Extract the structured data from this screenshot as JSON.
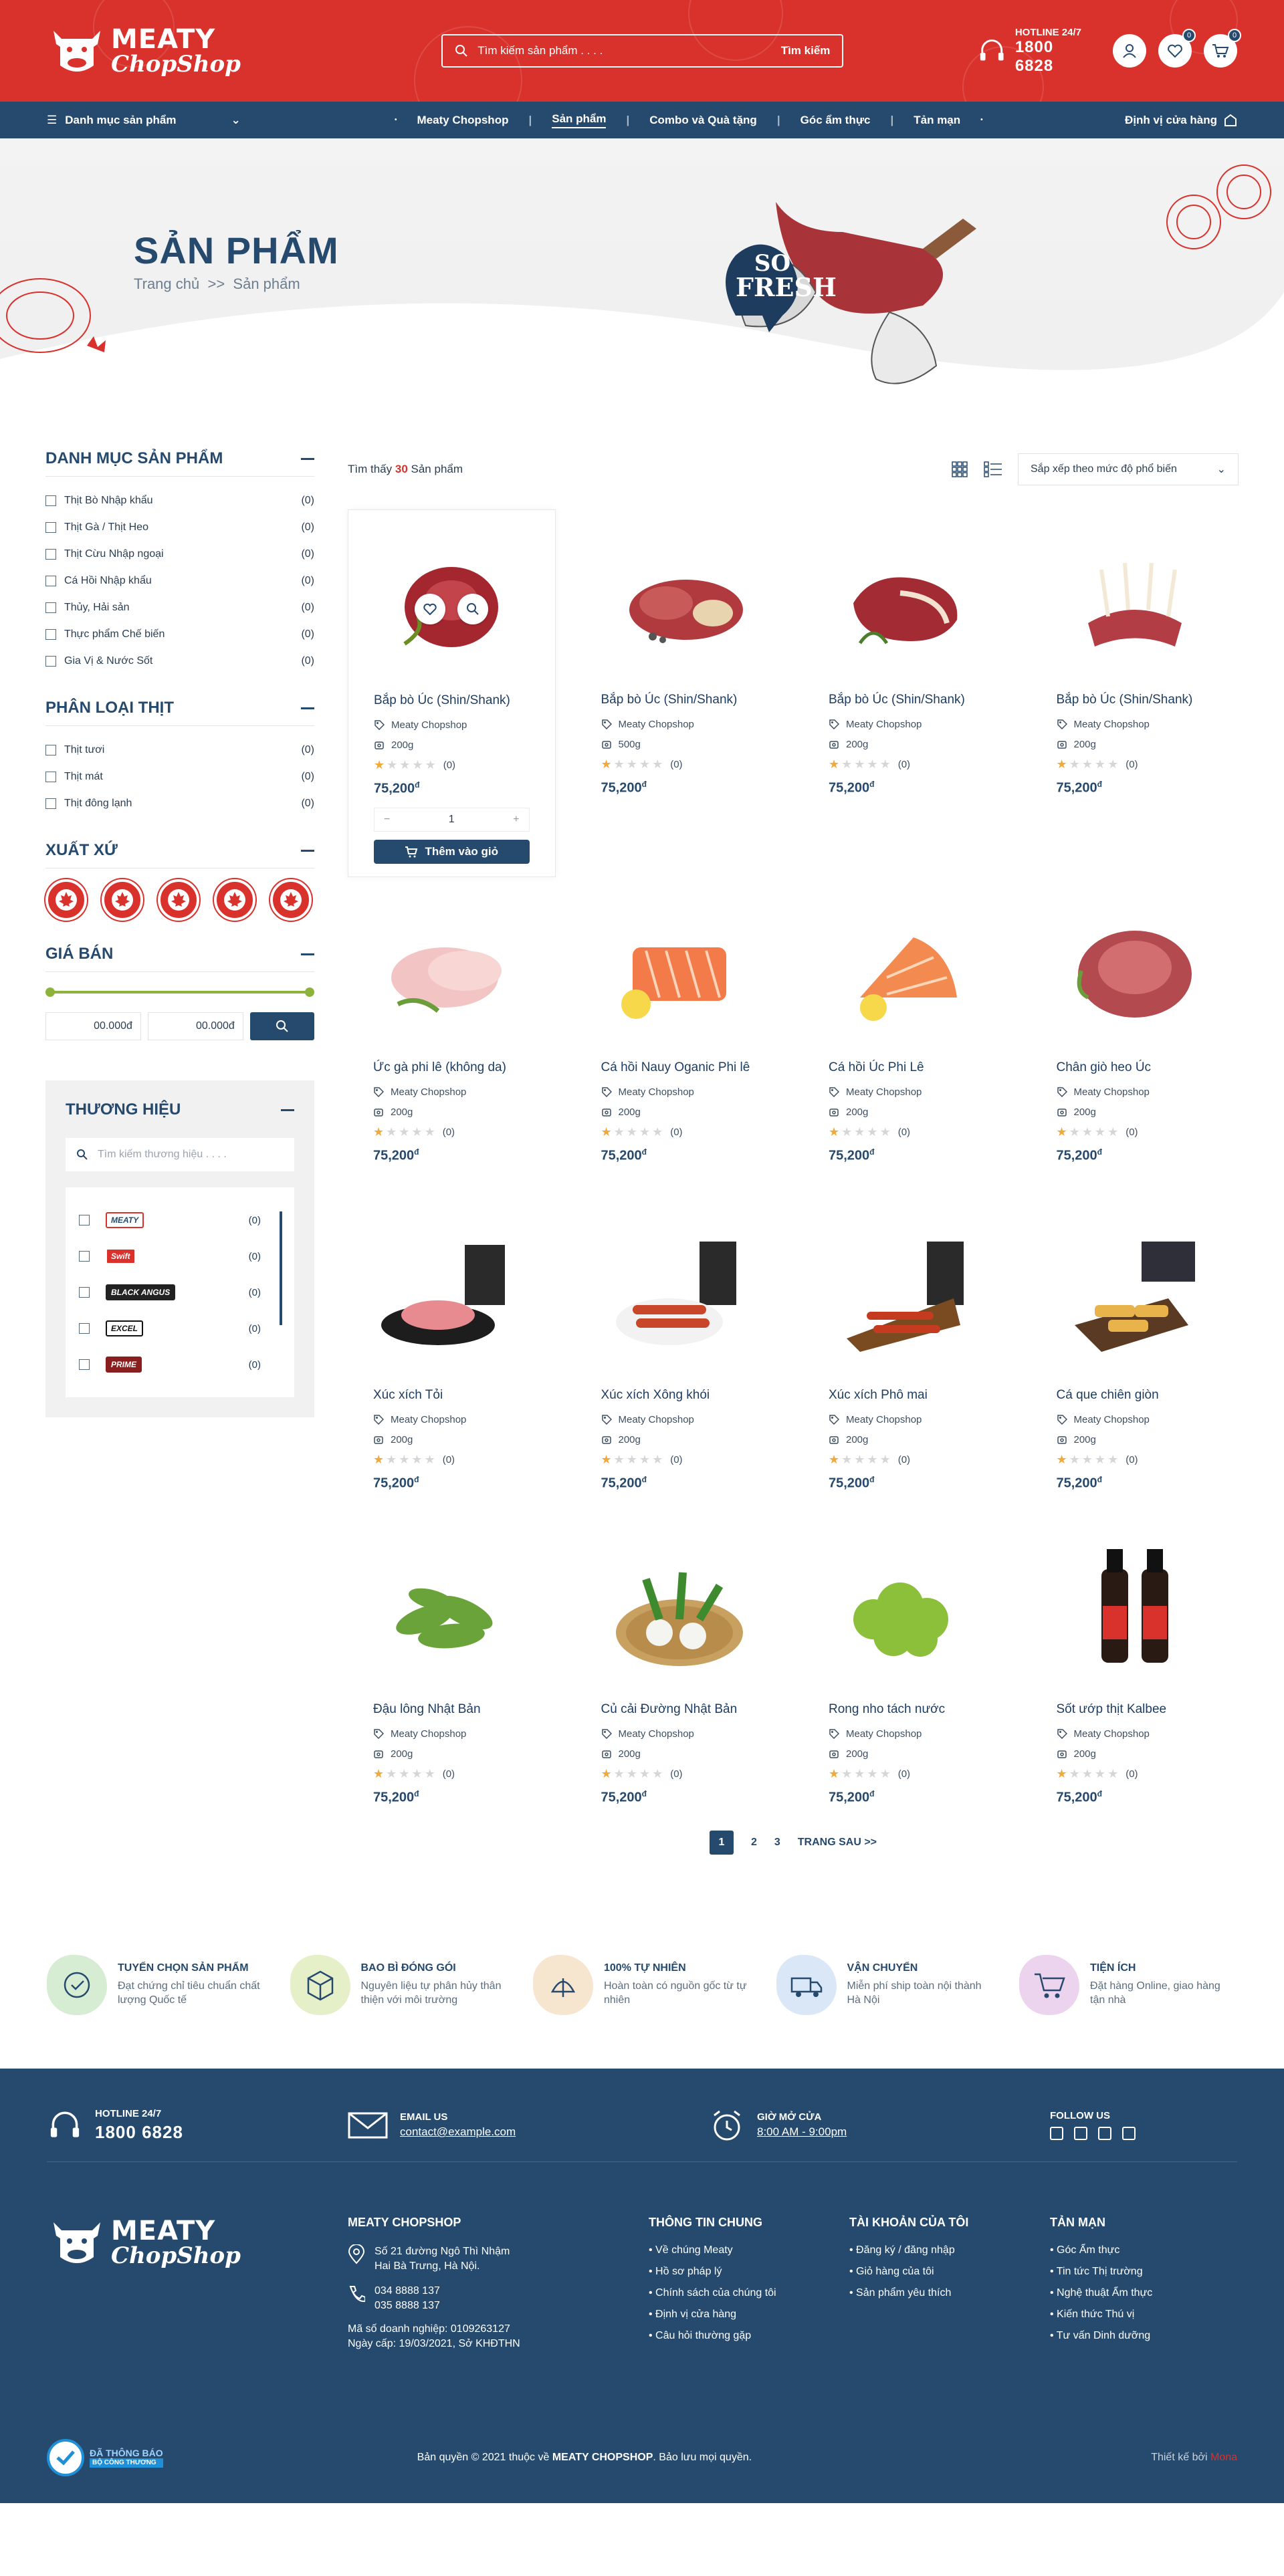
{
  "header": {
    "logo_line1": "MEATY",
    "logo_line2": "ChopShop",
    "search_placeholder": "Tìm kiếm sản phẩm . . . .",
    "search_button": "Tìm kiếm",
    "hotline_label": "HOTLINE 24/7",
    "hotline_number": "1800 6828",
    "wishlist_count": "0",
    "cart_count": "0",
    "brand_color": "#d9312c",
    "navy_color": "#264a6e"
  },
  "nav": {
    "category_menu": "Danh mục sản phẩm",
    "links": [
      "Meaty Chopshop",
      "Sản phẩm",
      "Combo và Quà tặng",
      "Góc ẩm thực",
      "Tản mạn"
    ],
    "active": "Sản phẩm",
    "store_locator": "Định vị cửa hàng"
  },
  "hero": {
    "title": "SẢN PHẨM",
    "crumb_home": "Trang chủ",
    "crumb_sep": ">>",
    "crumb_current": "Sản phẩm",
    "badge_line1": "SO",
    "badge_line2": "FRESH"
  },
  "sidebar": {
    "categories_title": "DANH MỤC SẢN PHẨM",
    "categories": [
      {
        "label": "Thịt Bò Nhập khẩu",
        "count": "(0)"
      },
      {
        "label": "Thịt Gà / Thịt Heo",
        "count": "(0)"
      },
      {
        "label": "Thịt Cừu Nhập ngoại",
        "count": "(0)"
      },
      {
        "label": "Cá Hồi Nhập khẩu",
        "count": "(0)"
      },
      {
        "label": "Thủy, Hải sản",
        "count": "(0)"
      },
      {
        "label": "Thực phẩm Chế biến",
        "count": "(0)"
      },
      {
        "label": "Gia Vị & Nước Sốt",
        "count": "(0)"
      }
    ],
    "meat_types_title": "PHÂN LOẠI THỊT",
    "meat_types": [
      {
        "label": "Thịt tươi",
        "count": "(0)"
      },
      {
        "label": "Thịt mát",
        "count": "(0)"
      },
      {
        "label": "Thịt đông lạnh",
        "count": "(0)"
      }
    ],
    "origin_title": "XUẤT XỨ",
    "origin_flag_count": 5,
    "price_title": "GIÁ BÁN",
    "price_min": "00.000đ",
    "price_max": "00.000đ",
    "brands_title": "THƯƠNG HIỆU",
    "brands_placeholder": "Tìm kiếm thương hiệu . . . .",
    "brands": [
      {
        "name": "MEATY",
        "count": "(0)"
      },
      {
        "name": "Swift",
        "count": "(0)"
      },
      {
        "name": "BLACK ANGUS",
        "count": "(0)"
      },
      {
        "name": "EXCEL",
        "count": "(0)"
      },
      {
        "name": "PRIME",
        "count": "(0)"
      }
    ]
  },
  "toolbar": {
    "found_prefix": "Tìm thấy",
    "found_count": "30",
    "found_suffix": "Sản phẩm",
    "sort_label": "Sắp xếp theo mức độ phổ biến"
  },
  "products": [
    {
      "name": "Bắp bò Úc (Shin/Shank)",
      "brand": "Meaty Chopshop",
      "weight": "200g",
      "rating": "(0)",
      "price": "75,200",
      "currency": "đ",
      "icon": "beef-shank"
    },
    {
      "name": "Bắp bò Úc (Shin/Shank)",
      "brand": "Meaty Chopshop",
      "weight": "500g",
      "rating": "(0)",
      "price": "75,200",
      "currency": "đ",
      "icon": "beef-pieces"
    },
    {
      "name": "Bắp bò Úc (Shin/Shank)",
      "brand": "Meaty Chopshop",
      "weight": "200g",
      "rating": "(0)",
      "price": "75,200",
      "currency": "đ",
      "icon": "steak"
    },
    {
      "name": "Bắp bò Úc (Shin/Shank)",
      "brand": "Meaty Chopshop",
      "weight": "200g",
      "rating": "(0)",
      "price": "75,200",
      "currency": "đ",
      "icon": "lamb-rack"
    },
    {
      "name": "Ức gà phi lê (không da)",
      "brand": "Meaty Chopshop",
      "weight": "200g",
      "rating": "(0)",
      "price": "75,200",
      "currency": "đ",
      "icon": "chicken-breast"
    },
    {
      "name": "Cá hồi Nauy Oganic Phi lê",
      "brand": "Meaty Chopshop",
      "weight": "200g",
      "rating": "(0)",
      "price": "75,200",
      "currency": "đ",
      "icon": "salmon"
    },
    {
      "name": "Cá hồi Úc Phi Lê",
      "brand": "Meaty Chopshop",
      "weight": "200g",
      "rating": "(0)",
      "price": "75,200",
      "currency": "đ",
      "icon": "salmon-fillet"
    },
    {
      "name": "Chân giò heo Úc",
      "brand": "Meaty Chopshop",
      "weight": "200g",
      "rating": "(0)",
      "price": "75,200",
      "currency": "đ",
      "icon": "pork-leg"
    },
    {
      "name": "Xúc xích Tỏi",
      "brand": "Meaty Chopshop",
      "weight": "200g",
      "rating": "(0)",
      "price": "75,200",
      "currency": "đ",
      "icon": "garlic-sausage"
    },
    {
      "name": "Xúc xích Xông khói",
      "brand": "Meaty Chopshop",
      "weight": "200g",
      "rating": "(0)",
      "price": "75,200",
      "currency": "đ",
      "icon": "smoked-sausage"
    },
    {
      "name": "Xúc xích Phô mai",
      "brand": "Meaty Chopshop",
      "weight": "200g",
      "rating": "(0)",
      "price": "75,200",
      "currency": "đ",
      "icon": "cheese-sausage"
    },
    {
      "name": "Cá que chiên giòn",
      "brand": "Meaty Chopshop",
      "weight": "200g",
      "rating": "(0)",
      "price": "75,200",
      "currency": "đ",
      "icon": "fish-sticks"
    },
    {
      "name": "Đậu lông Nhật Bản",
      "brand": "Meaty Chopshop",
      "weight": "200g",
      "rating": "(0)",
      "price": "75,200",
      "currency": "đ",
      "icon": "edamame"
    },
    {
      "name": "Củ cải Đường Nhật Bản",
      "brand": "Meaty Chopshop",
      "weight": "200g",
      "rating": "(0)",
      "price": "75,200",
      "currency": "đ",
      "icon": "turnip"
    },
    {
      "name": "Rong nho tách nước",
      "brand": "Meaty Chopshop",
      "weight": "200g",
      "rating": "(0)",
      "price": "75,200",
      "currency": "đ",
      "icon": "sea-grapes"
    },
    {
      "name": "Sốt ướp thịt Kalbee",
      "brand": "Meaty Chopshop",
      "weight": "200g",
      "rating": "(0)",
      "price": "75,200",
      "currency": "đ",
      "icon": "sauce-bottles"
    }
  ],
  "first_card": {
    "qty": "1",
    "add_to_cart": "Thêm vào giỏ"
  },
  "pagination": {
    "pages": [
      "1",
      "2",
      "3"
    ],
    "current": "1",
    "next": "TRANG SAU"
  },
  "features": [
    {
      "title": "TUYỂN CHỌN SẢN PHẨM",
      "desc": "Đạt chứng chỉ tiêu chuẩn chất lượng Quốc tế",
      "color": "#d6ecd3"
    },
    {
      "title": "BAO BÌ ĐÓNG GÓI",
      "desc": "Nguyên liệu tự phân hủy thân thiện với môi trường",
      "color": "#e6f0c8"
    },
    {
      "title": "100% TỰ NHIÊN",
      "desc": "Hoàn toàn có nguồn gốc từ tự nhiên",
      "color": "#f6e5cf"
    },
    {
      "title": "VẬN CHUYỂN",
      "desc": "Miễn phí ship toàn nội thành Hà Nội",
      "color": "#d9e7f7"
    },
    {
      "title": "TIỆN ÍCH",
      "desc": "Đặt hàng Online, giao hàng tận nhà",
      "color": "#ecd3ee"
    }
  ],
  "footer": {
    "hotline_label": "HOTLINE 24/7",
    "hotline": "1800 6828",
    "email_label": "EMAIL US",
    "email": "contact@example.com",
    "hours_label": "GIỜ MỞ CỬA",
    "hours": "8:00 AM - 9:00pm",
    "follow_label": "FOLLOW US",
    "company_title": "MEATY CHOPSHOP",
    "address_line1": "Số 21 đường Ngô Thì Nhậm",
    "address_line2": "Hai Bà Trưng, Hà Nội.",
    "phone1": "034 8888 137",
    "phone2": "035 8888 137",
    "tax": "Mã số doanh nghiệp: 0109263127",
    "issued": "Ngày cấp: 19/03/2021, Sở KHĐTHN",
    "col_info_title": "THÔNG TIN CHUNG",
    "col_info": [
      "Về chúng Meaty",
      "Hồ sơ pháp lý",
      "Chính sách của chúng tôi",
      "Định vị cửa hàng",
      "Câu hỏi thường gặp"
    ],
    "col_account_title": "TÀI KHOẢN CỦA TÔI",
    "col_account": [
      "Đăng ký / đăng nhập",
      "Giỏ hàng của tôi",
      "Sản phẩm yêu thích"
    ],
    "col_blog_title": "TẢN MẠN",
    "col_blog": [
      "Góc Ẩm thực",
      "Tin tức Thị trường",
      "Nghệ thuật Ẩm thực",
      "Kiến thức Thú vị",
      "Tư vấn Dinh dưỡng"
    ],
    "dmca_line1": "ĐÃ THÔNG BÁO",
    "dmca_line2": "BỘ CÔNG THƯƠNG",
    "copyright_prefix": "Bản quyền © 2021 thuộc về",
    "copyright_brand": "MEATY CHOPSHOP",
    "copyright_suffix": ". Bảo lưu mọi quyền.",
    "designer_prefix": "Thiết kế bởi",
    "designer": "Mona"
  }
}
